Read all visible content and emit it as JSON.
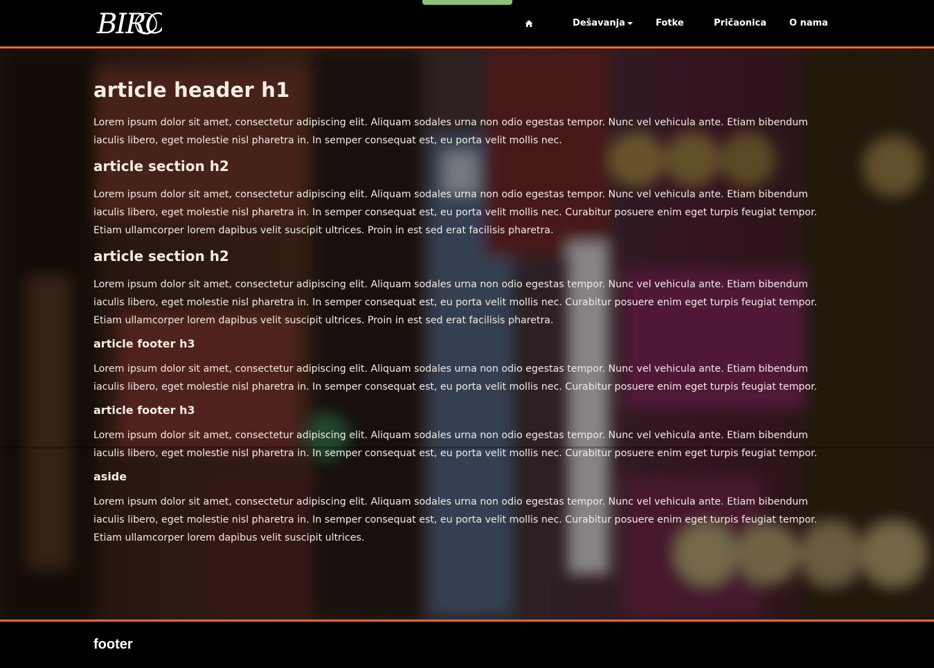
{
  "brand": {
    "logo_text": "BIRO"
  },
  "nav": {
    "home_icon": "home-icon",
    "items": [
      {
        "label": "Dešavanja",
        "has_dropdown": true
      },
      {
        "label": "Fotke"
      },
      {
        "label": "Pričaonica"
      },
      {
        "label": "O nama"
      }
    ]
  },
  "colors": {
    "accent": "#e8692d",
    "nav_background": "#000000",
    "nav_tab": "#8fbf7a",
    "text": "#f1ebe5"
  },
  "article": {
    "header_h1": "article header h1",
    "intro": "Lorem ipsum dolor sit amet, consectetur adipiscing elit. Aliquam sodales urna non odio egestas tempor. Nunc vel vehicula ante. Etiam bibendum iaculis libero, eget molestie nisl pharetra in. In semper consequat est, eu porta velit mollis nec.",
    "sections": [
      {
        "heading": "article section h2",
        "text": "Lorem ipsum dolor sit amet, consectetur adipiscing elit. Aliquam sodales urna non odio egestas tempor. Nunc vel vehicula ante. Etiam bibendum iaculis libero, eget molestie nisl pharetra in. In semper consequat est, eu porta velit mollis nec. Curabitur posuere enim eget turpis feugiat tempor. Etiam ullamcorper lorem dapibus velit suscipit ultrices. Proin in est sed erat facilisis pharetra."
      },
      {
        "heading": "article section h2",
        "text": "Lorem ipsum dolor sit amet, consectetur adipiscing elit. Aliquam sodales urna non odio egestas tempor. Nunc vel vehicula ante. Etiam bibendum iaculis libero, eget molestie nisl pharetra in. In semper consequat est, eu porta velit mollis nec. Curabitur posuere enim eget turpis feugiat tempor. Etiam ullamcorper lorem dapibus velit suscipit ultrices. Proin in est sed erat facilisis pharetra."
      }
    ],
    "footers": [
      {
        "heading": "article footer h3",
        "text": "Lorem ipsum dolor sit amet, consectetur adipiscing elit. Aliquam sodales urna non odio egestas tempor. Nunc vel vehicula ante. Etiam bibendum iaculis libero, eget molestie nisl pharetra in. In semper consequat est, eu porta velit mollis nec. Curabitur posuere enim eget turpis feugiat tempor."
      },
      {
        "heading": "article footer h3",
        "text": "Lorem ipsum dolor sit amet, consectetur adipiscing elit. Aliquam sodales urna non odio egestas tempor. Nunc vel vehicula ante. Etiam bibendum iaculis libero, eget molestie nisl pharetra in. In semper consequat est, eu porta velit mollis nec. Curabitur posuere enim eget turpis feugiat tempor."
      }
    ]
  },
  "aside": {
    "heading": "aside",
    "text": "Lorem ipsum dolor sit amet, consectetur adipiscing elit. Aliquam sodales urna non odio egestas tempor. Nunc vel vehicula ante. Etiam bibendum iaculis libero, eget molestie nisl pharetra in. In semper consequat est, eu porta velit mollis nec. Curabitur posuere enim eget turpis feugiat tempor. Etiam ullamcorper lorem dapibus velit suscipit ultrices."
  },
  "footer": {
    "label": "footer"
  }
}
